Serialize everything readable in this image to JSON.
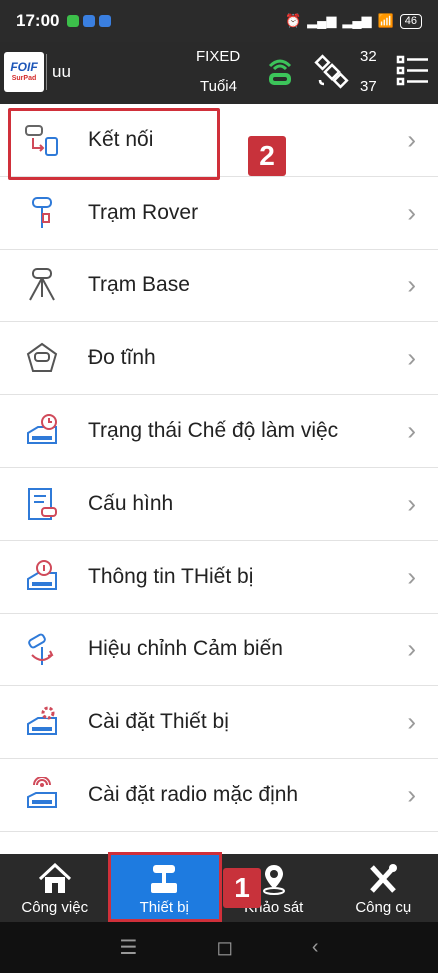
{
  "status": {
    "time": "17:00",
    "battery": "46"
  },
  "header": {
    "logo_top": "FOIF",
    "logo_bottom": "SurPad",
    "user": "uu",
    "fix_status": "FIXED",
    "age": "Tuổi4",
    "sat_top": "32",
    "sat_bottom": "37"
  },
  "menu": {
    "items": [
      {
        "label": "Kết nối",
        "icon": "connection-icon"
      },
      {
        "label": "Trạm Rover",
        "icon": "rover-icon"
      },
      {
        "label": "Trạm Base",
        "icon": "base-station-icon"
      },
      {
        "label": "Đo tĩnh",
        "icon": "static-survey-icon"
      },
      {
        "label": "Trạng thái Chế độ làm việc",
        "icon": "work-mode-icon"
      },
      {
        "label": "Cấu hình",
        "icon": "config-icon"
      },
      {
        "label": "Thông tin THiết bị",
        "icon": "device-info-icon"
      },
      {
        "label": "Hiệu chỉnh Cảm biến",
        "icon": "sensor-calibration-icon"
      },
      {
        "label": "Cài đặt Thiết bị",
        "icon": "device-settings-icon"
      },
      {
        "label": "Cài đặt radio mặc định",
        "icon": "radio-settings-icon"
      }
    ],
    "chevron": "›"
  },
  "annotations": {
    "badge1": "1",
    "badge2": "2"
  },
  "bottom_nav": [
    {
      "label": "Công việc",
      "icon": "home-icon",
      "active": false
    },
    {
      "label": "Thiết bị",
      "icon": "device-icon",
      "active": true
    },
    {
      "label": "Khảo sát",
      "icon": "survey-icon",
      "active": false
    },
    {
      "label": "Công cụ",
      "icon": "tools-icon",
      "active": false
    }
  ],
  "colors": {
    "accent": "#1e7be0",
    "highlight": "#d0303a",
    "header": "#2a2a2a"
  }
}
